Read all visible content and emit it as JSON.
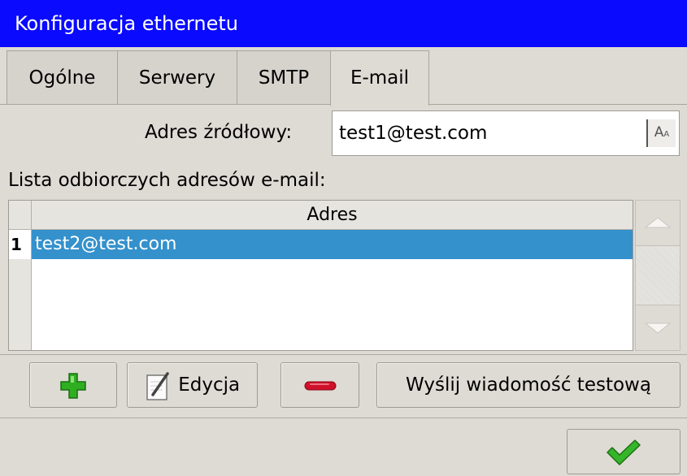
{
  "window": {
    "title": "Konfiguracja ethernetu"
  },
  "tabs": [
    {
      "label": "Ogólne"
    },
    {
      "label": "Serwery"
    },
    {
      "label": "SMTP"
    },
    {
      "label": "E-mail"
    }
  ],
  "source_address": {
    "label": "Adres źródłowy:",
    "value": "test1@test.com",
    "keyboard_icon": "keyboard-icon"
  },
  "recipients": {
    "label": "Lista odbiorczych adresów e-mail:",
    "column_header": "Adres",
    "rows": [
      {
        "index": "1",
        "address": "test2@test.com"
      }
    ]
  },
  "buttons": {
    "add_icon": "plus-icon",
    "edit_label": "Edycja",
    "edit_icon": "pencil-icon",
    "remove_icon": "minus-icon",
    "send_test_label": "Wyślij wiadomość testową",
    "ok_icon": "checkmark-icon"
  },
  "colors": {
    "titlebar": "#0a0aff",
    "selection": "#3491cc",
    "add_green": "#2eae20",
    "remove_red": "#d0102a",
    "ok_green": "#35b62a"
  }
}
